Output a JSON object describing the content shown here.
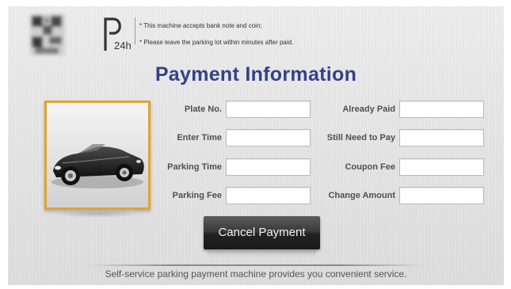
{
  "header": {
    "logo_text": "24h",
    "notice_line1": "* This machine accepts bank note and coin;",
    "notice_line2": "* Please leave the parking lot within     minutes after paid."
  },
  "title": "Payment Information",
  "form": {
    "left": [
      {
        "label": "Plate No.",
        "value": ""
      },
      {
        "label": "Enter Time",
        "value": ""
      },
      {
        "label": "Parking Time",
        "value": ""
      },
      {
        "label": "Parking Fee",
        "value": ""
      }
    ],
    "right": [
      {
        "label": "Already Paid",
        "value": ""
      },
      {
        "label": "Still Need to Pay",
        "value": ""
      },
      {
        "label": "Coupon Fee",
        "value": ""
      },
      {
        "label": "Change Amount",
        "value": ""
      }
    ]
  },
  "cancel_button": "Cancel Payment",
  "footer": "Self-service parking payment machine provides you convenient service.",
  "colors": {
    "title": "#33418a",
    "photo_border": "#e0a52c",
    "button": "#2a2a2a"
  },
  "icons": {
    "qr": "qr-code-icon",
    "logo": "parking-24h-icon",
    "car": "car-photo"
  }
}
